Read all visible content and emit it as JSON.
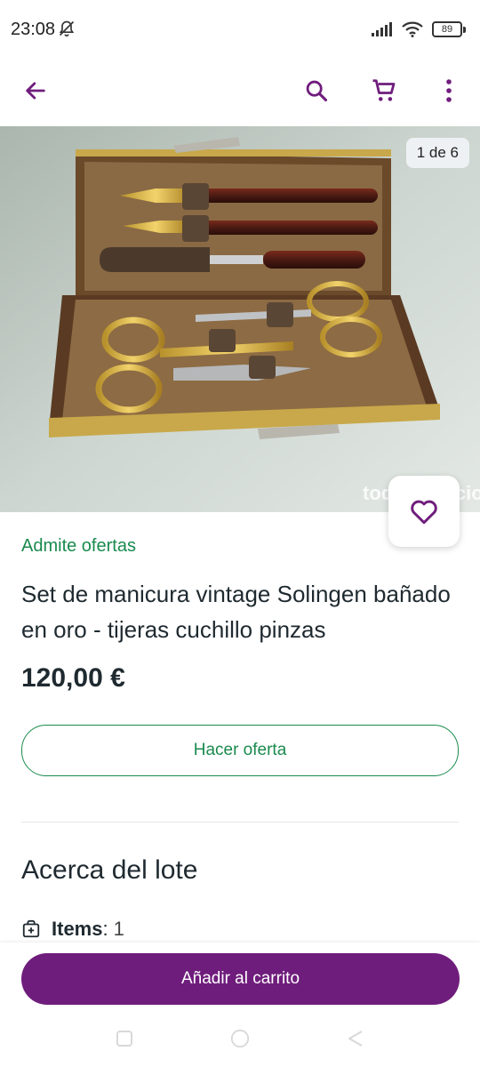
{
  "status_bar": {
    "time": "23:08",
    "battery": "89",
    "icons": [
      "bell-off-icon",
      "signal-icon",
      "wifi-icon",
      "battery-icon"
    ]
  },
  "toolbar": {
    "icons": [
      "back-arrow-icon",
      "search-icon",
      "cart-icon",
      "more-vertical-icon"
    ],
    "accent_color": "#6f1d7c"
  },
  "gallery": {
    "counter": "1 de 6",
    "watermark": "todocoleccion"
  },
  "product": {
    "offers_tag": "Admite ofertas",
    "title": "Set de manicura vintage Solingen bañado en oro - tijeras cuchillo pinzas",
    "price": "120,00 €",
    "offer_button": "Hacer oferta"
  },
  "about": {
    "title": "Acerca del lote",
    "items_label": "Items",
    "items_value": "1"
  },
  "cart_button": "Añadir al carrito",
  "colors": {
    "brand_purple": "#6f1d7c",
    "offer_green": "#1a8a4e"
  }
}
